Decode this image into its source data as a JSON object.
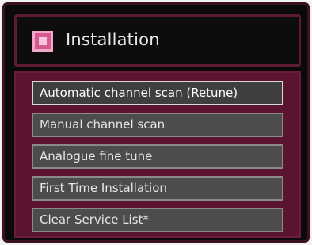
{
  "header": {
    "icon": "settings-icon",
    "title": "Installation"
  },
  "menu": {
    "items": [
      {
        "label": "Automatic channel scan (Retune)",
        "selected": true
      },
      {
        "label": "Manual channel scan",
        "selected": false
      },
      {
        "label": "Analogue fine tune",
        "selected": false
      },
      {
        "label": "First Time Installation",
        "selected": false
      },
      {
        "label": "Clear Service List*",
        "selected": false
      }
    ]
  },
  "colors": {
    "frame_background": "#0a0a0a",
    "accent": "#5a1430",
    "icon": "#d85a92",
    "item_background": "#4c4c4c"
  }
}
